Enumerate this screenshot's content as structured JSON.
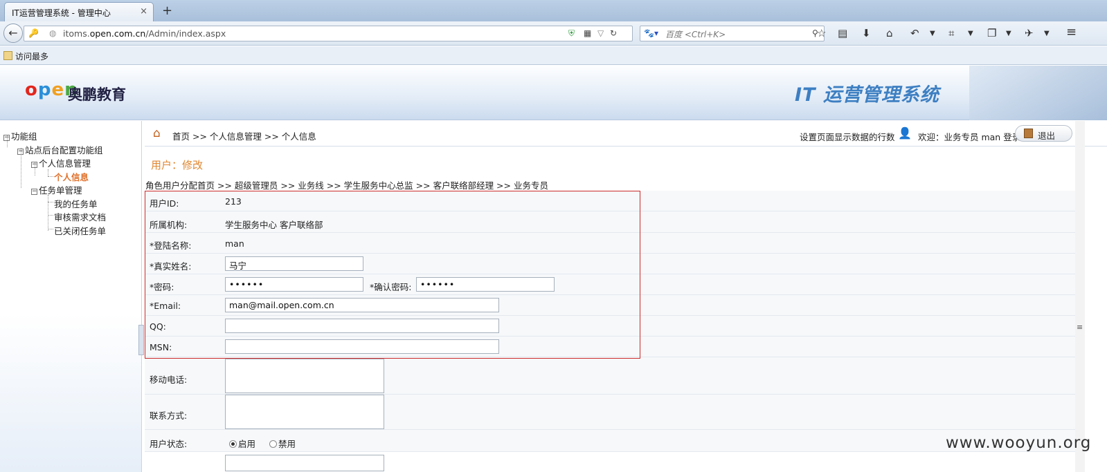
{
  "browser": {
    "tab_title": "IT运营管理系统 - 管理中心",
    "tab_close": "×",
    "new_tab": "+",
    "url_prefix": "itoms.",
    "url_host": "open.com.cn",
    "url_path": "/Admin/index.aspx",
    "search_placeholder": "百度 <Ctrl+K>",
    "bookmark": "访问最多"
  },
  "header": {
    "logo_cn": "奥鹏教育",
    "system_title": "IT 运营管理系统"
  },
  "sidebar": {
    "root": "功能组",
    "group": "站点后台配置功能组",
    "personal": "个人信息管理",
    "personal_info": "个人信息",
    "tasks": "任务单管理",
    "my_tasks": "我的任务单",
    "review_docs": "审核需求文档",
    "closed_tasks": "已关闭任务单"
  },
  "topbar": {
    "breadcrumb": "首页 >> 个人信息管理 >> 个人信息",
    "row_setting": "设置页面显示数据的行数",
    "welcome": "欢迎：业务专员 man 登录",
    "logout": "退出"
  },
  "page": {
    "title": "用户：修改",
    "role_crumb": "角色用户分配首页 >> 超级管理员 >> 业务线 >> 学生服务中心总监 >> 客户联络部经理 >> 业务专员"
  },
  "form": {
    "user_id_label": "用户ID:",
    "user_id": "213",
    "org_label": "所属机构:",
    "org": "学生服务中心 客户联络部",
    "login_label": "*登陆名称:",
    "login": "man",
    "realname_label": "*真实姓名:",
    "realname": "马宁",
    "password_label": "*密码:",
    "password": "••••••",
    "confirm_label": "*确认密码:",
    "confirm": "••••••",
    "email_label": "*Email:",
    "email": "man@mail.open.com.cn",
    "qq_label": "QQ:",
    "msn_label": "MSN:",
    "mobile_label": "移动电话:",
    "contact_label": "联系方式:",
    "status_label": "用户状态:",
    "status_on": "启用",
    "status_off": "禁用"
  },
  "watermark": "www.wooyun.org"
}
